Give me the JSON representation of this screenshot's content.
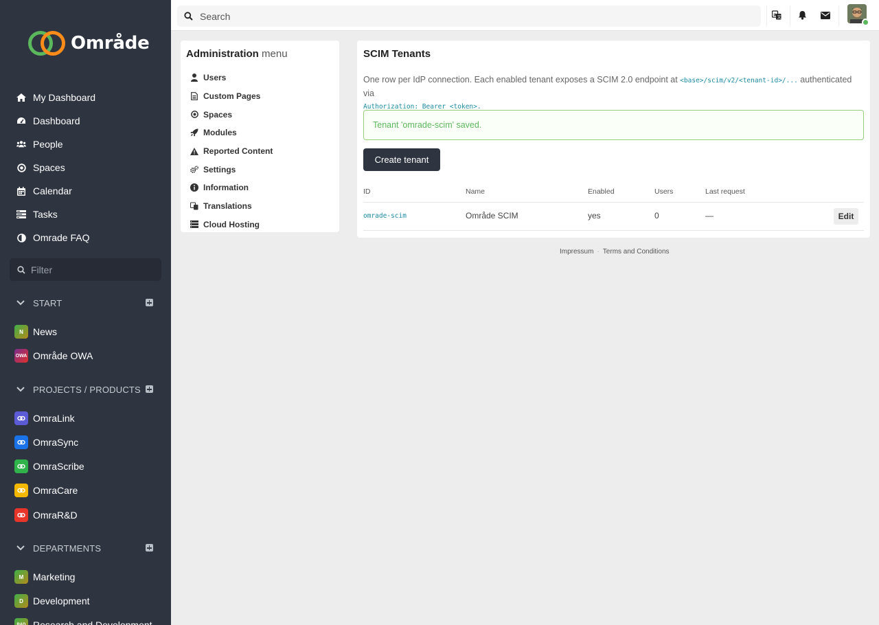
{
  "app": {
    "name": "Område"
  },
  "sidebar": {
    "nav": [
      {
        "label": "My Dashboard",
        "icon": "home-icon"
      },
      {
        "label": "Dashboard",
        "icon": "tachometer-icon"
      },
      {
        "label": "People",
        "icon": "users-icon"
      },
      {
        "label": "Spaces",
        "icon": "dot-circle-icon"
      },
      {
        "label": "Calendar",
        "icon": "calendar-icon"
      },
      {
        "label": "Tasks",
        "icon": "tasks-icon"
      },
      {
        "label": "Omrade FAQ",
        "icon": "half-circle-icon"
      }
    ],
    "filter_placeholder": "Filter",
    "groups": [
      {
        "title": "START",
        "items": [
          {
            "label": "News",
            "badge": "N",
            "color": "#6aa52c"
          },
          {
            "label": "Område OWA",
            "badge": "OWA",
            "color": "#b5256e"
          }
        ]
      },
      {
        "title": "PROJECTS / PRODUCTS",
        "items": [
          {
            "label": "OmraLink",
            "color": "#5b5bd6"
          },
          {
            "label": "OmraSync",
            "color": "#1a73e8"
          },
          {
            "label": "OmraScribe",
            "color": "#2fb34a"
          },
          {
            "label": "OmraCare",
            "color": "#f5b800"
          },
          {
            "label": "OmraR&D",
            "color": "#e8352a"
          }
        ]
      },
      {
        "title": "DEPARTMENTS",
        "items": [
          {
            "label": "Marketing",
            "badge": "M",
            "color": "#6aa52c"
          },
          {
            "label": "Development",
            "badge": "D",
            "color": "#6aa52c"
          },
          {
            "label": "Research and Development",
            "badge": "R&D",
            "color": "#6aa52c"
          }
        ]
      }
    ]
  },
  "topbar": {
    "search_placeholder": "Search"
  },
  "admin_menu": {
    "title_bold": "Administration",
    "title_rest": "menu",
    "items": [
      {
        "label": "Users",
        "icon": "user-icon"
      },
      {
        "label": "Custom Pages",
        "icon": "file-icon"
      },
      {
        "label": "Spaces",
        "icon": "dot-circle-icon"
      },
      {
        "label": "Modules",
        "icon": "rocket-icon"
      },
      {
        "label": "Reported Content",
        "icon": "warning-icon"
      },
      {
        "label": "Settings",
        "icon": "cogs-icon"
      },
      {
        "label": "Information",
        "icon": "info-icon"
      },
      {
        "label": "Translations",
        "icon": "language-icon"
      },
      {
        "label": "Cloud Hosting",
        "icon": "server-icon"
      }
    ]
  },
  "main": {
    "title": "SCIM Tenants",
    "description_prefix": "One row per IdP connection. Each enabled tenant exposes a SCIM 2.0 endpoint at",
    "endpoint_code": "<base>/scim/v2/<tenant-id>/...",
    "description_mid": "authenticated via",
    "auth_code": "Authorization: Bearer <token>.",
    "alert": "Tenant 'omrade-scim' saved.",
    "create_button": "Create tenant",
    "columns": [
      "ID",
      "Name",
      "Enabled",
      "Users",
      "Last request"
    ],
    "rows": [
      {
        "id": "omrade-scim",
        "name": "Område SCIM",
        "enabled": "yes",
        "users": "0",
        "last_request": "—",
        "action": "Edit"
      }
    ]
  },
  "footer": {
    "links": [
      "Impressum",
      "Terms and Conditions"
    ]
  }
}
